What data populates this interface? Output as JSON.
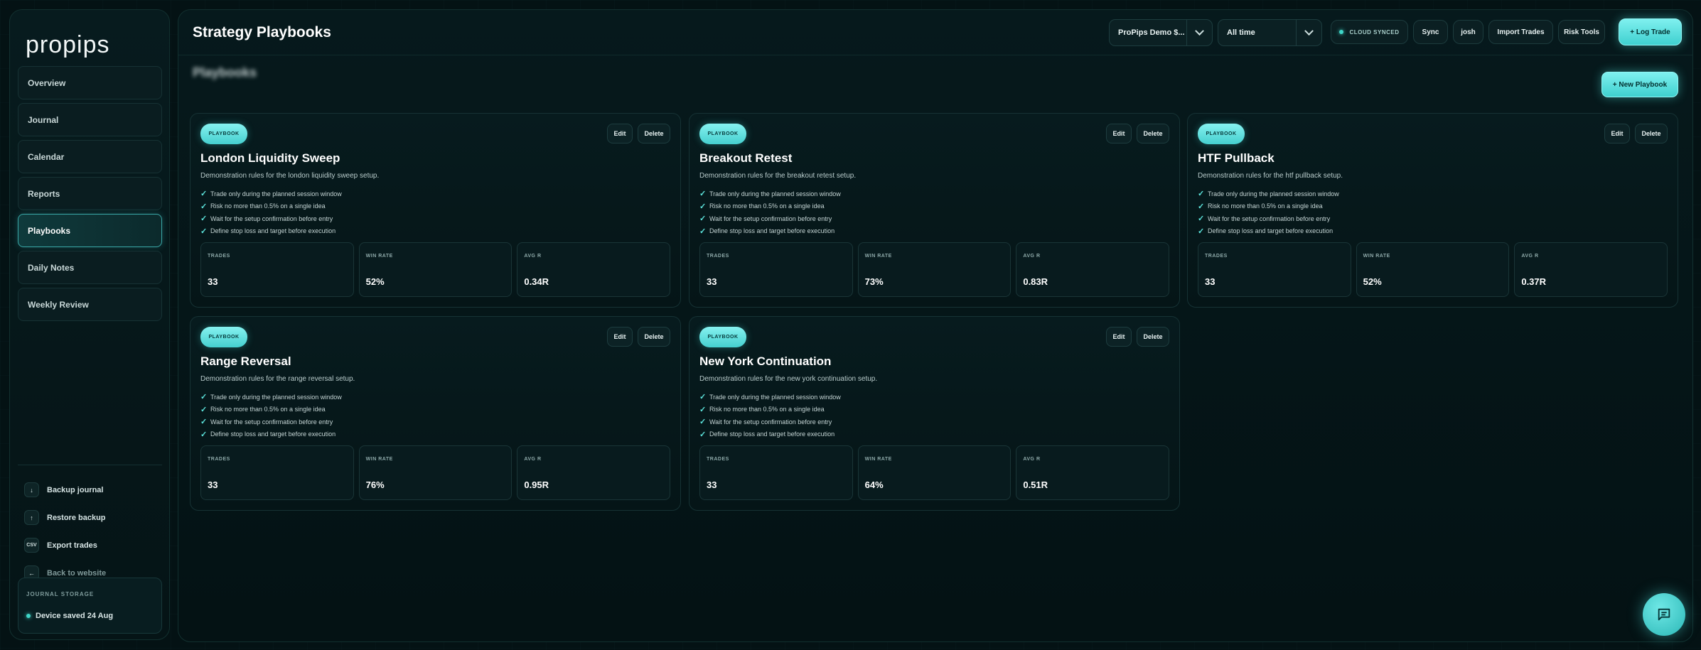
{
  "brand": {
    "logo": "propips"
  },
  "sidebar": {
    "items": [
      {
        "label": "Overview",
        "active": false
      },
      {
        "label": "Journal",
        "active": false
      },
      {
        "label": "Calendar",
        "active": false
      },
      {
        "label": "Reports",
        "active": false
      },
      {
        "label": "Playbooks",
        "active": true
      },
      {
        "label": "Daily Notes",
        "active": false
      },
      {
        "label": "Weekly Review",
        "active": false
      }
    ],
    "actions": [
      {
        "icon": "↓",
        "icon_name": "download-icon",
        "label": "Backup journal"
      },
      {
        "icon": "↑",
        "icon_name": "upload-icon",
        "label": "Restore backup"
      },
      {
        "icon": "CSV",
        "icon_name": "csv-icon",
        "label": "Export trades"
      },
      {
        "icon": "←",
        "icon_name": "arrow-left-icon",
        "label": "Back to website"
      }
    ],
    "storage": {
      "title": "JOURNAL STORAGE",
      "status": "Device saved 24 Aug"
    }
  },
  "header": {
    "title": "Strategy Playbooks",
    "account_select": "ProPips Demo $...",
    "range_select": "All time",
    "sync_status": "CLOUD SYNCED",
    "sync_button": "Sync",
    "user_button": "josh",
    "import_button": "Import Trades",
    "risk_button": "Risk Tools",
    "log_button": "+ Log Trade"
  },
  "main": {
    "section_title": "Playbooks",
    "new_button": "+ New Playbook"
  },
  "card_labels": {
    "badge": "PLAYBOOK",
    "edit": "Edit",
    "delete": "Delete",
    "check": "✓",
    "trades": "TRADES",
    "win_rate": "WIN RATE",
    "avg_r": "AVG R"
  },
  "playbooks": [
    {
      "title": "London Liquidity Sweep",
      "description": "Demonstration rules for the london liquidity sweep setup.",
      "rules": [
        "Trade only during the planned session window",
        "Risk no more than 0.5% on a single idea",
        "Wait for the setup confirmation before entry",
        "Define stop loss and target before execution"
      ],
      "trades": "33",
      "win_rate": "52%",
      "avg_r": "0.34R"
    },
    {
      "title": "Breakout Retest",
      "description": "Demonstration rules for the breakout retest setup.",
      "rules": [
        "Trade only during the planned session window",
        "Risk no more than 0.5% on a single idea",
        "Wait for the setup confirmation before entry",
        "Define stop loss and target before execution"
      ],
      "trades": "33",
      "win_rate": "73%",
      "avg_r": "0.83R"
    },
    {
      "title": "HTF Pullback",
      "description": "Demonstration rules for the htf pullback setup.",
      "rules": [
        "Trade only during the planned session window",
        "Risk no more than 0.5% on a single idea",
        "Wait for the setup confirmation before entry",
        "Define stop loss and target before execution"
      ],
      "trades": "33",
      "win_rate": "52%",
      "avg_r": "0.37R"
    },
    {
      "title": "Range Reversal",
      "description": "Demonstration rules for the range reversal setup.",
      "rules": [
        "Trade only during the planned session window",
        "Risk no more than 0.5% on a single idea",
        "Wait for the setup confirmation before entry",
        "Define stop loss and target before execution"
      ],
      "trades": "33",
      "win_rate": "76%",
      "avg_r": "0.95R"
    },
    {
      "title": "New York Continuation",
      "description": "Demonstration rules for the new york continuation setup.",
      "rules": [
        "Trade only during the planned session window",
        "Risk no more than 0.5% on a single idea",
        "Wait for the setup confirmation before entry",
        "Define stop loss and target before execution"
      ],
      "trades": "33",
      "win_rate": "64%",
      "avg_r": "0.51R"
    }
  ],
  "colors": {
    "accent": "#5ee3df",
    "background": "#041214",
    "panel": "#071b1e"
  },
  "icons": {
    "chat": "chat-bubble-icon",
    "chevron": "chevron-down-icon"
  }
}
